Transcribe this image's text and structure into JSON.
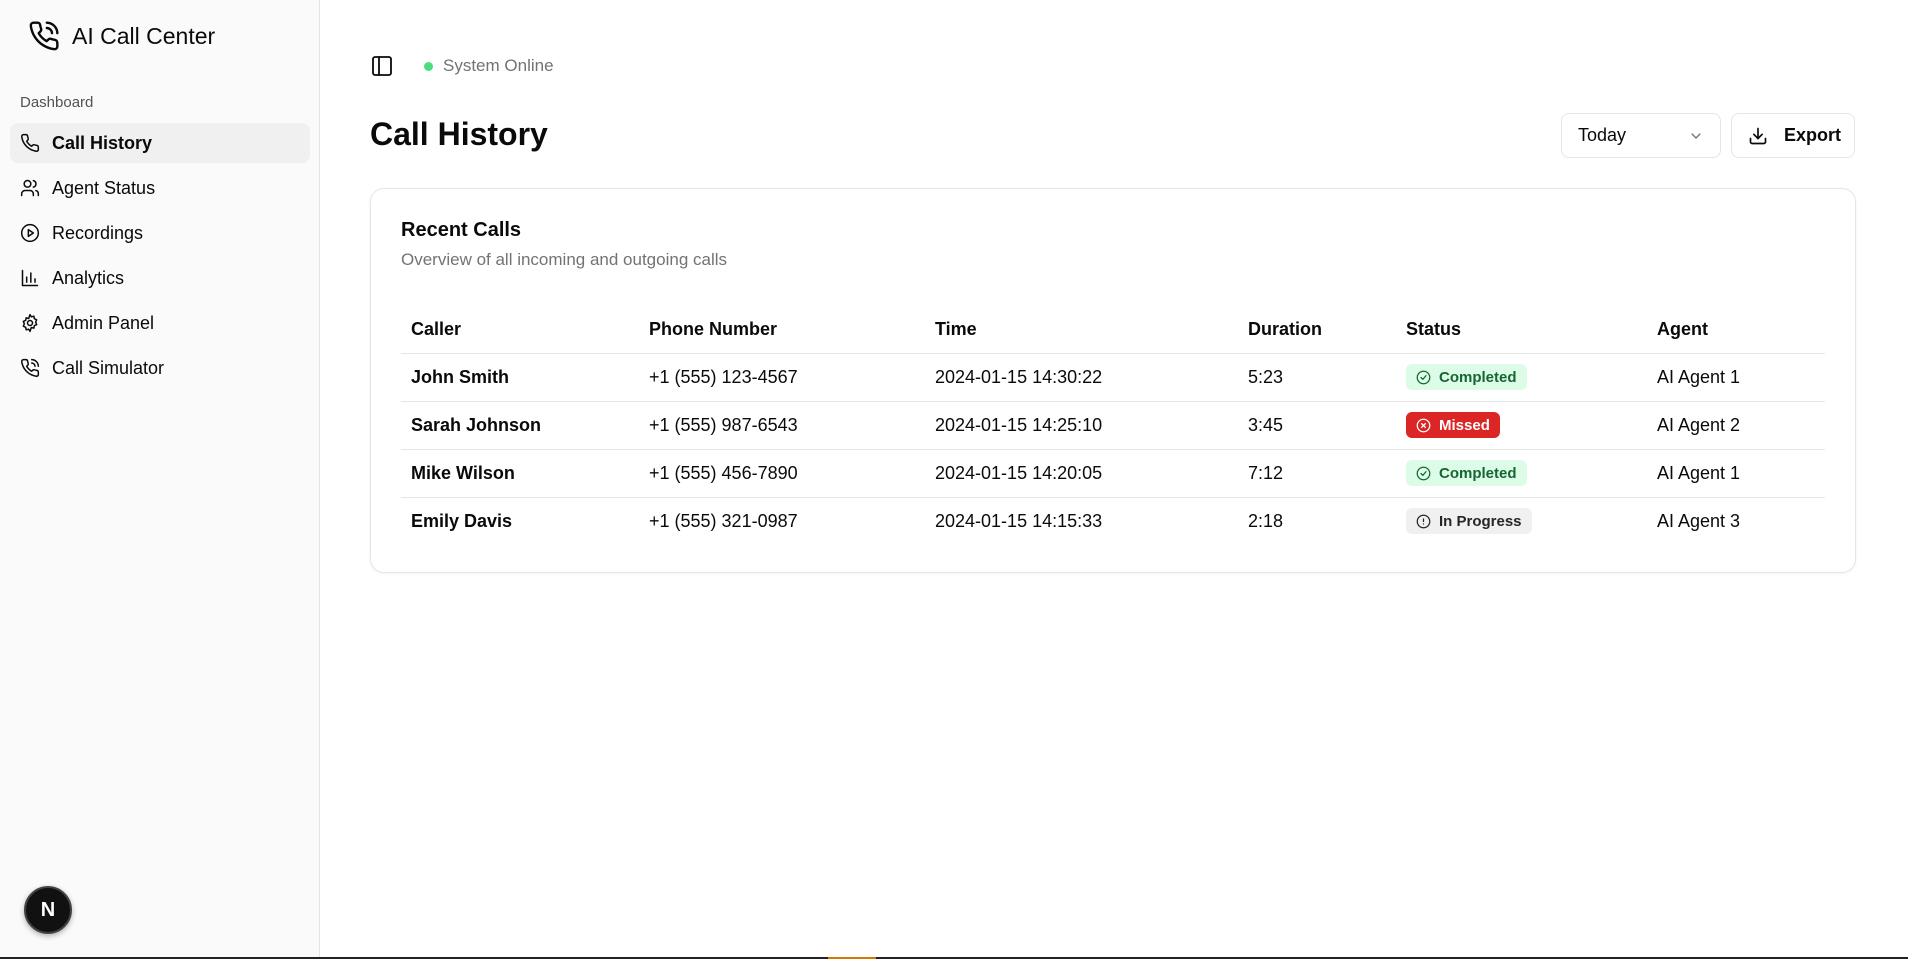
{
  "brand": {
    "name": "AI Call Center",
    "icon": "phone-call-icon"
  },
  "sidebar": {
    "group_label": "Dashboard",
    "items": [
      {
        "label": "Call History",
        "icon": "phone-icon",
        "active": true
      },
      {
        "label": "Agent Status",
        "icon": "users-icon",
        "active": false
      },
      {
        "label": "Recordings",
        "icon": "play-circle-icon",
        "active": false
      },
      {
        "label": "Analytics",
        "icon": "bar-chart-icon",
        "active": false
      },
      {
        "label": "Admin Panel",
        "icon": "settings-icon",
        "active": false
      },
      {
        "label": "Call Simulator",
        "icon": "phone-call-icon",
        "active": false
      }
    ],
    "badge_letter": "N"
  },
  "header": {
    "status_text": "System Online",
    "status_color": "#4ade80"
  },
  "page": {
    "title": "Call History",
    "date_filter": "Today",
    "export_label": "Export"
  },
  "card": {
    "title": "Recent Calls",
    "description": "Overview of all incoming and outgoing calls",
    "columns": [
      "Caller",
      "Phone Number",
      "Time",
      "Duration",
      "Status",
      "Agent"
    ],
    "rows": [
      {
        "caller": "John Smith",
        "phone": "+1 (555) 123-4567",
        "time": "2024-01-15 14:30:22",
        "duration": "5:23",
        "status": "Completed",
        "agent": "AI Agent 1"
      },
      {
        "caller": "Sarah Johnson",
        "phone": "+1 (555) 987-6543",
        "time": "2024-01-15 14:25:10",
        "duration": "3:45",
        "status": "Missed",
        "agent": "AI Agent 2"
      },
      {
        "caller": "Mike Wilson",
        "phone": "+1 (555) 456-7890",
        "time": "2024-01-15 14:20:05",
        "duration": "7:12",
        "status": "Completed",
        "agent": "AI Agent 1"
      },
      {
        "caller": "Emily Davis",
        "phone": "+1 (555) 321-0987",
        "time": "2024-01-15 14:15:33",
        "duration": "2:18",
        "status": "In Progress",
        "agent": "AI Agent 3"
      }
    ]
  },
  "colors": {
    "completed_bg": "#dcfce7",
    "missed_bg": "#dc2626",
    "progress_bg": "#f0f0f0"
  }
}
